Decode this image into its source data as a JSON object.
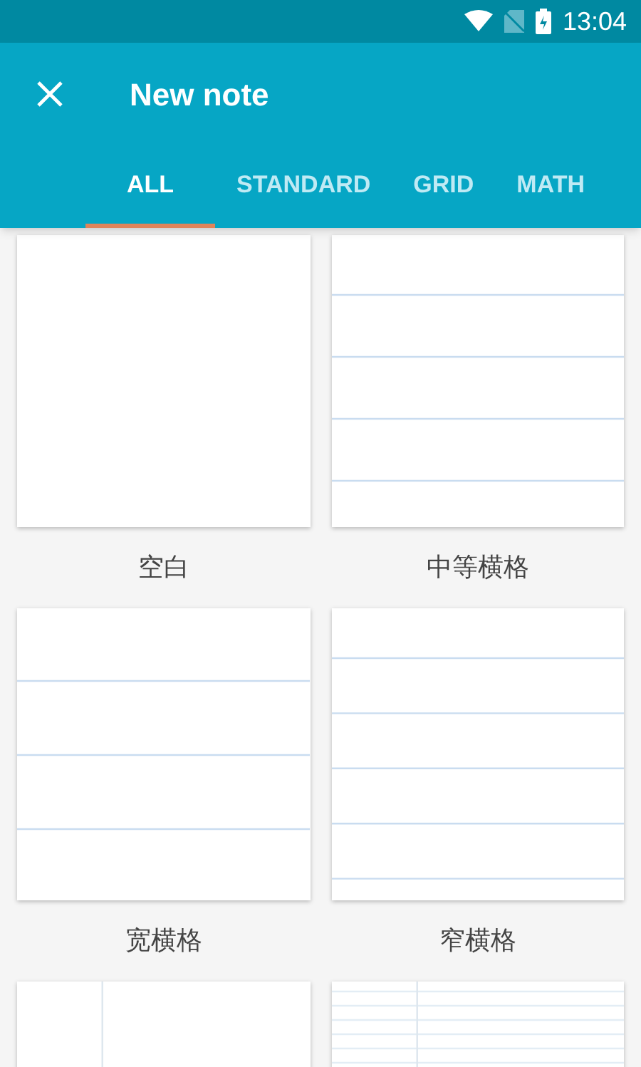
{
  "status_bar": {
    "time": "13:04"
  },
  "app_bar": {
    "title": "New note"
  },
  "tabs": [
    {
      "label": "ALL",
      "selected": true
    },
    {
      "label": "STANDARD",
      "selected": false
    },
    {
      "label": "GRID",
      "selected": false
    },
    {
      "label": "MATH",
      "selected": false
    }
  ],
  "templates": [
    {
      "kind": "blank",
      "label": "空白"
    },
    {
      "kind": "medium",
      "label": "中等横格"
    },
    {
      "kind": "wide",
      "label": "宽横格"
    },
    {
      "kind": "narrow",
      "label": "窄横格"
    },
    {
      "kind": "margin"
    },
    {
      "kind": "margin-narrow"
    }
  ]
}
